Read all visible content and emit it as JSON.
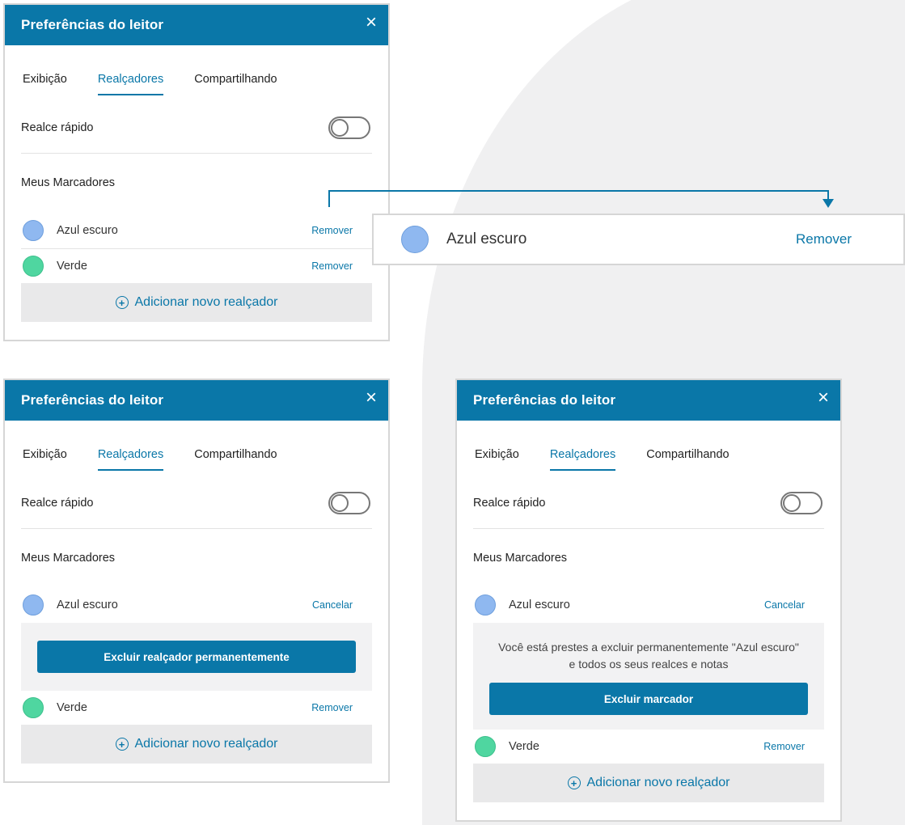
{
  "header": {
    "title": "Preferências do leitor",
    "close_symbol": "×"
  },
  "tabs": {
    "display": "Exibição",
    "highlighters": "Realçadores",
    "sharing": "Compartilhando"
  },
  "quick_highlight": {
    "label": "Realce rápido",
    "enabled": false
  },
  "markers": {
    "section_title": "Meus Marcadores",
    "items": [
      {
        "name": "Azul escuro",
        "color": "#8fb8f0"
      },
      {
        "name": "Verde",
        "color": "#4fd6a0"
      }
    ]
  },
  "actions": {
    "remove": "Remover",
    "cancel": "Cancelar",
    "add_new": "Adicionar novo realçador",
    "add_icon": "+",
    "delete_permanent": "Excluir realçador permanentemente",
    "delete_marker": "Excluir marcador"
  },
  "confirm_message": "Você está prestes a excluir permanentemente \"Azul escuro\" e todos os seus realces e notas",
  "colors": {
    "accent": "#0a77a8",
    "background_shape": "#f0f0f1"
  }
}
